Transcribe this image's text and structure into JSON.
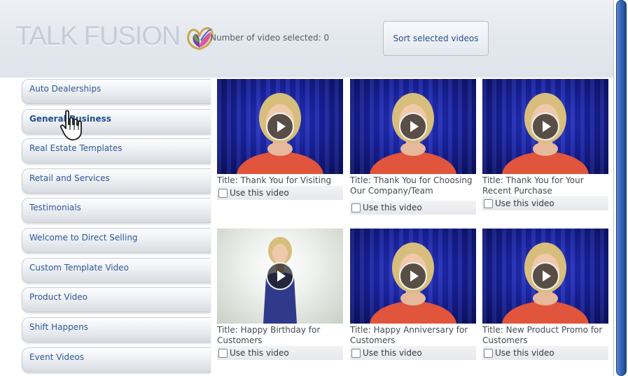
{
  "header": {
    "logo_text": "TALK FUSION",
    "selected_label": "Number of video selected: 0",
    "sort_button": "Sort selected videos"
  },
  "sidebar": {
    "items": [
      {
        "label": "Auto Dealerships",
        "active": false
      },
      {
        "label": "General Business",
        "active": true
      },
      {
        "label": "Real Estate Templates",
        "active": false
      },
      {
        "label": "Retail and Services",
        "active": false
      },
      {
        "label": "Testimonials",
        "active": false
      },
      {
        "label": "Welcome to Direct Selling",
        "active": false
      },
      {
        "label": "Custom Template Video",
        "active": false
      },
      {
        "label": "Product Video",
        "active": false
      },
      {
        "label": "Shift Happens",
        "active": false
      },
      {
        "label": "Event Videos",
        "active": false
      }
    ]
  },
  "videos": [
    {
      "title": "Title: Thank You for Visiting",
      "use_label": "Use this video",
      "checked": false,
      "thumb": "blue-curtain"
    },
    {
      "title": "Title: Thank You for Choosing Our Company/Team",
      "use_label": "Use this video",
      "checked": false,
      "thumb": "blue-curtain"
    },
    {
      "title": "Title: Thank You for Your Recent Purchase",
      "use_label": "Use this video",
      "checked": false,
      "thumb": "blue-curtain"
    },
    {
      "title": "Title: Happy Birthday for Customers",
      "use_label": "Use this video",
      "checked": false,
      "thumb": "white-studio"
    },
    {
      "title": "Title: Happy Anniversary for Customers",
      "use_label": "Use this video",
      "checked": false,
      "thumb": "blue-curtain"
    },
    {
      "title": "Title: New Product Promo for Customers",
      "use_label": "Use this video",
      "checked": false,
      "thumb": "blue-curtain"
    }
  ],
  "colors": {
    "link_blue": "#2c5a98",
    "curtain_blue": "#1a24a8",
    "scrollbar_blue": "#3a6bc4"
  },
  "icons": {
    "play": "play-icon",
    "cursor": "hand-pointer-icon",
    "logo": "butterfly-logo-icon"
  }
}
